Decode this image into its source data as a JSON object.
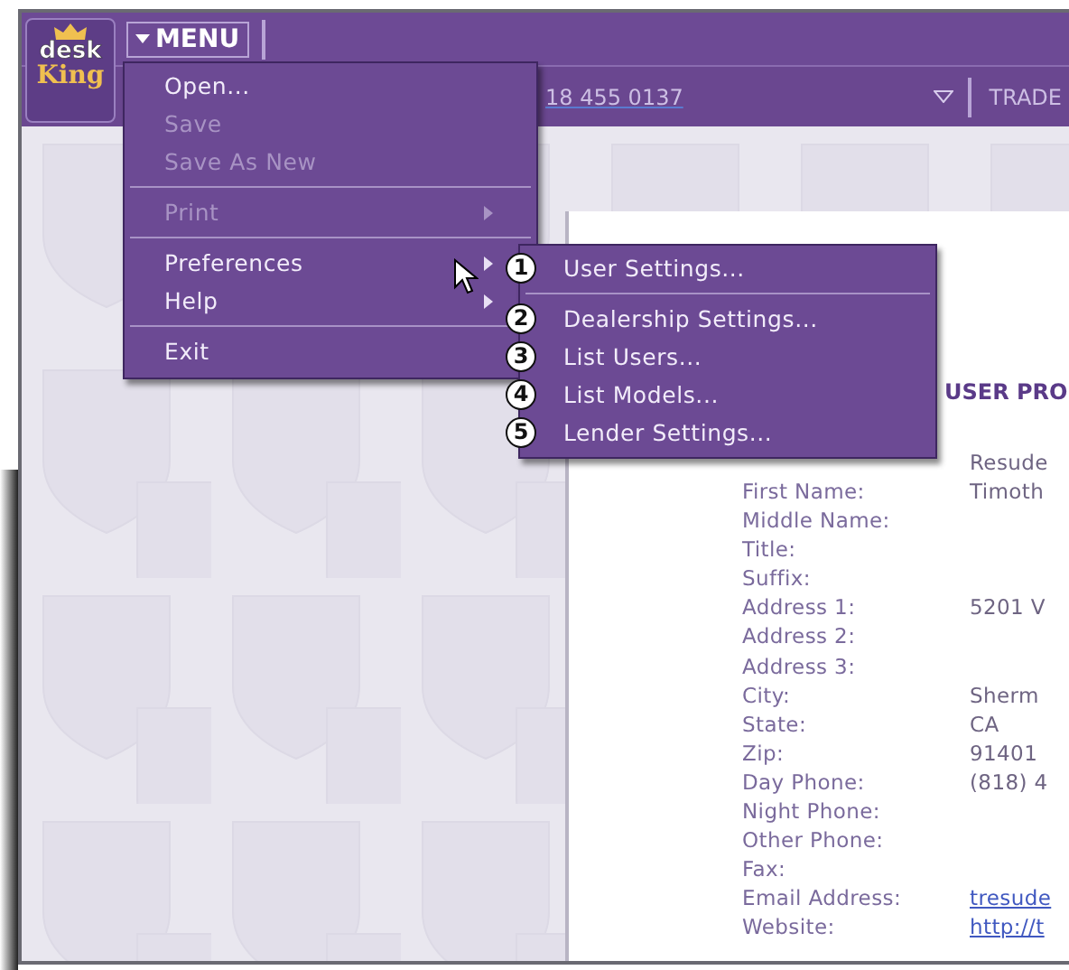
{
  "header": {
    "logo_top": "desk",
    "logo_bottom": "King",
    "menu_button": "MENU",
    "phone": "18 455 0137",
    "trade": "TRADE"
  },
  "menu": {
    "items": [
      {
        "kind": "item",
        "label": "Open...",
        "disabled": false,
        "submenu": false
      },
      {
        "kind": "item",
        "label": "Save",
        "disabled": true,
        "submenu": false
      },
      {
        "kind": "item",
        "label": "Save As New",
        "disabled": true,
        "submenu": false
      },
      {
        "kind": "separator"
      },
      {
        "kind": "item",
        "label": "Print",
        "disabled": true,
        "submenu": true
      },
      {
        "kind": "separator"
      },
      {
        "kind": "item",
        "label": "Preferences",
        "disabled": false,
        "submenu": true
      },
      {
        "kind": "item",
        "label": "Help",
        "disabled": false,
        "submenu": true
      },
      {
        "kind": "separator"
      },
      {
        "kind": "item",
        "label": "Exit",
        "disabled": false,
        "submenu": false
      }
    ]
  },
  "submenu": {
    "items": [
      {
        "kind": "item",
        "callout": "1",
        "label": "User Settings..."
      },
      {
        "kind": "separator"
      },
      {
        "kind": "item",
        "callout": "2",
        "label": "Dealership Settings..."
      },
      {
        "kind": "item",
        "callout": "3",
        "label": "List Users..."
      },
      {
        "kind": "item",
        "callout": "4",
        "label": "List Models..."
      },
      {
        "kind": "item",
        "callout": "5",
        "label": "Lender Settings..."
      }
    ]
  },
  "profile": {
    "heading": "USER PRO",
    "top_value": "Resude",
    "fields": [
      {
        "label": "First Name:",
        "value": "Timoth",
        "kind": "text"
      },
      {
        "label": "Middle Name:"
      },
      {
        "label": "Title:"
      },
      {
        "label": "Suffix:"
      },
      {
        "label": "Address 1:",
        "value": "5201 V",
        "kind": "text"
      },
      {
        "label": "Address 2:"
      },
      {
        "label": "Address 3:"
      },
      {
        "label": "City:",
        "value": "Sherm",
        "kind": "text"
      },
      {
        "label": "State:",
        "value": "CA",
        "kind": "text"
      },
      {
        "label": "Zip:",
        "value": "91401",
        "kind": "text"
      },
      {
        "label": "Day Phone:",
        "value": "(818) 4",
        "kind": "text"
      },
      {
        "label": "Night Phone:"
      },
      {
        "label": "Other Phone:"
      },
      {
        "label": "Fax:"
      },
      {
        "label": "Email Address:",
        "value": "tresude",
        "kind": "link"
      },
      {
        "label": "Website:",
        "value": "http://t",
        "kind": "link"
      }
    ]
  }
}
